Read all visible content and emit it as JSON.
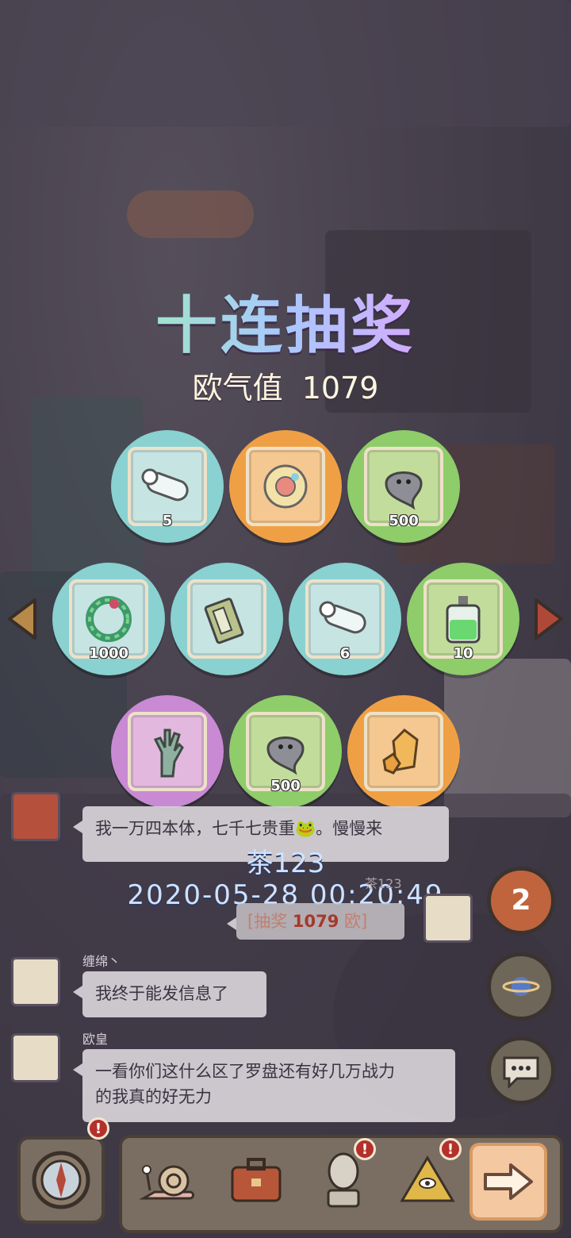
{
  "title": "十连抽奖",
  "luck": {
    "label": "欧气值",
    "value": "1079"
  },
  "rewards": [
    {
      "icon": "scroll-icon",
      "qty": "5",
      "bg": "#8ad1d1",
      "card": "#c6e4e2"
    },
    {
      "icon": "compass-disc-icon",
      "qty": "",
      "bg": "#f0a044",
      "card": "#f4c890"
    },
    {
      "icon": "ghost-blob-icon",
      "qty": "500",
      "bg": "#8ecd6a",
      "card": "#c2dc9c"
    },
    {
      "icon": "wreath-icon",
      "qty": "1000",
      "bg": "#8ad1d1",
      "card": "#c6e4e2"
    },
    {
      "icon": "book-icon",
      "qty": "",
      "bg": "#8ad1d1",
      "card": "#c6e4e2"
    },
    {
      "icon": "scroll-icon",
      "qty": "6",
      "bg": "#8ad1d1",
      "card": "#c6e4e2"
    },
    {
      "icon": "potion-icon",
      "qty": "10",
      "bg": "#8ecd6a",
      "card": "#c2dc9c"
    },
    {
      "icon": "zombie-hand-icon",
      "qty": "",
      "bg": "#c98ad4",
      "card": "#e2b8de"
    },
    {
      "icon": "ghost-blob-icon",
      "qty": "500",
      "bg": "#8ecd6a",
      "card": "#c2dc9c"
    },
    {
      "icon": "crystal-icon",
      "qty": "",
      "bg": "#f0a044",
      "card": "#f4c890"
    }
  ],
  "chat": {
    "msg1": "我一万四本体，七千七贵重🐸。慢慢来",
    "winner_name": "茶123",
    "winner_time": "2020-05-28 00:20:49",
    "system_name": "茶123",
    "system_msg": {
      "pre": "[抽奖 ",
      "num": "1079",
      "post": " 欧]"
    },
    "user2": "缠绵丶",
    "msg2": "我终于能发信息了",
    "user3": "欧皇",
    "msg3a": "一看你们这什么区了罗盘还有好几万战力",
    "msg3b": "的我真的好无力"
  },
  "side": {
    "count_badge": "2",
    "alert": "!"
  },
  "nav": [
    "compass-icon",
    "snail-icon",
    "briefcase-icon",
    "statue-icon",
    "pyramid-icon",
    "next-arrow-icon"
  ]
}
